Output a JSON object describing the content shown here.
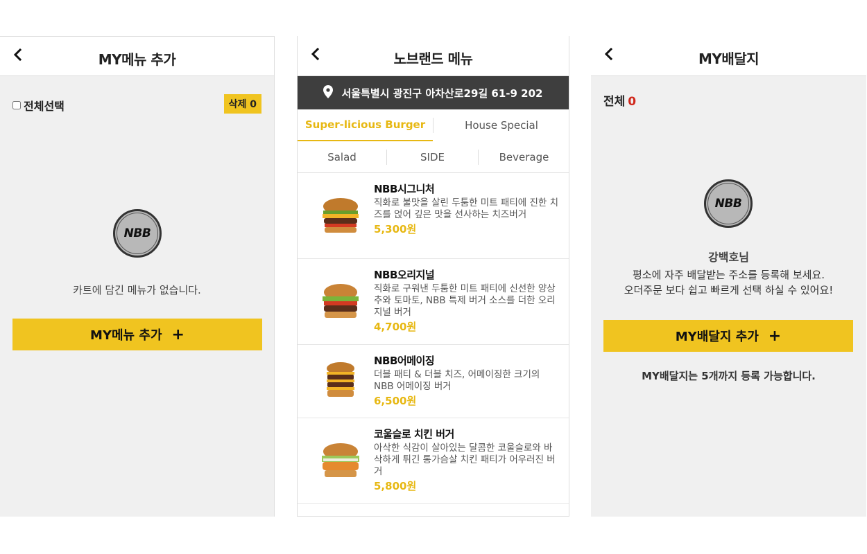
{
  "my_menu": {
    "title": "MY메뉴 추가",
    "select_all": "전체선택",
    "delete_label": "삭제",
    "delete_count": "0",
    "logo_text": "NBB",
    "empty_message": "카트에 담긴 메뉴가 없습니다.",
    "add_button": "MY메뉴 추가",
    "add_icon": "+"
  },
  "brand_menu": {
    "title": "노브랜드 메뉴",
    "address": "서울특별시 광진구 아차산로29길 61-9 202",
    "categories_row1": [
      "Super-licious Burger",
      "House Special"
    ],
    "categories_row2": [
      "Salad",
      "SIDE",
      "Beverage"
    ],
    "active_category": "Super-licious Burger",
    "accent_color": "#e7b813",
    "items": [
      {
        "name": "NBB시그니처",
        "desc": "직화로 불맛을 살린 두툼한 미트 패티에 진한 치즈를 얹어 깊은 맛을 선사하는 치즈버거",
        "price": "5,300원"
      },
      {
        "name": "NBB오리지널",
        "desc": "직화로 구워낸 두툼한 미트 패티에 신선한 양상추와 토마토, NBB 특제 버거 소스를 더한 오리지널 버거",
        "price": "4,700원"
      },
      {
        "name": "NBB어메이징",
        "desc": "더블 패티 & 더블 치즈, 어메이징한 크기의 NBB 어메이징 버거",
        "price": "6,500원"
      },
      {
        "name": "코울슬로 치킨 버거",
        "desc": "아삭한 식감이 살아있는 달콤한 코울슬로와 바삭하게 튀긴 통가슴살 치킨 패티가 어우러진 버거",
        "price": "5,800원"
      }
    ]
  },
  "my_delivery": {
    "title": "MY배달지",
    "total_label": "전체",
    "total_count": "0",
    "count_color": "#d0271b",
    "logo_text": "NBB",
    "user_name": "강백호님",
    "message_line1": "평소에 자주 배달받는 주소를 등록해 보세요.",
    "message_line2": "오더주문 보다 쉽고 빠르게 선택 하실 수 있어요!",
    "add_button": "MY배달지 추가",
    "add_icon": "+",
    "limit_note": "MY배달지는 5개까지 등록 가능합니다."
  }
}
